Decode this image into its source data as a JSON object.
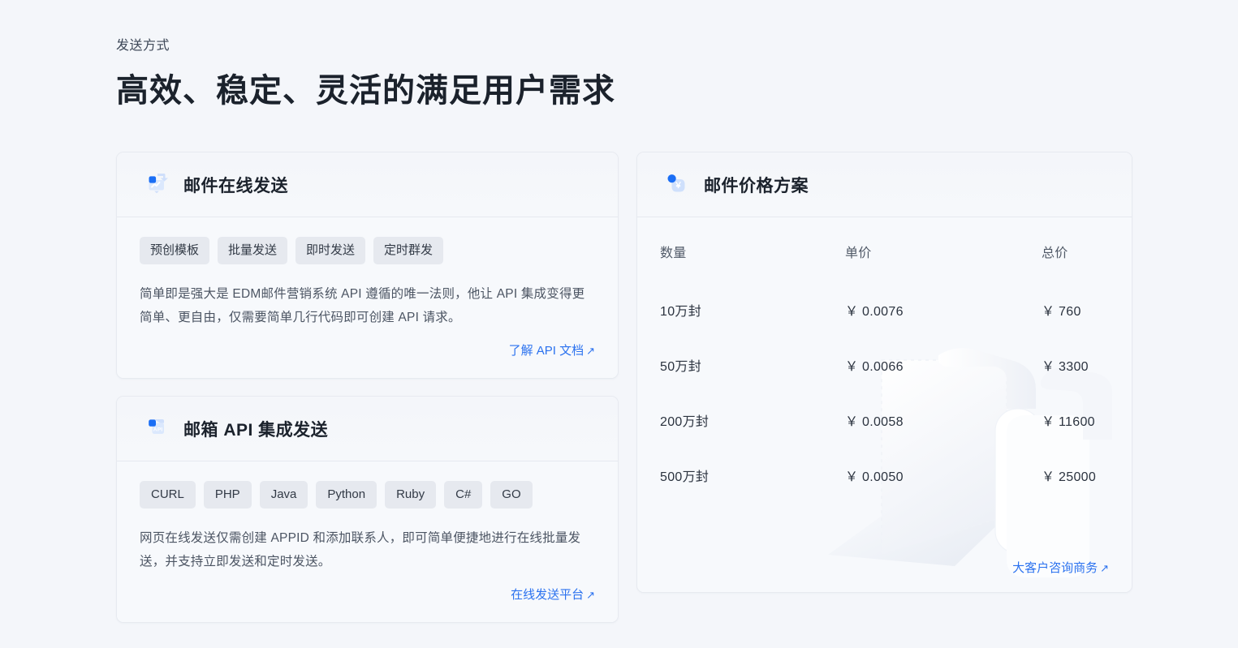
{
  "hero": {
    "eyebrow": "发送方式",
    "title": "高效、稳定、灵活的满足用户需求"
  },
  "cards": {
    "online_send": {
      "icon": "chart-screen-icon",
      "title": "邮件在线发送",
      "tags": [
        "预创模板",
        "批量发送",
        "即时发送",
        "定时群发"
      ],
      "description": "简单即是强大是 EDM邮件营销系统 API 遵循的唯一法则，他让 API 集成变得更简单、更自由，仅需要简单几行代码即可创建 API 请求。",
      "link": "了解 API 文档",
      "link_arrow": "↗"
    },
    "api_send": {
      "icon": "api-card-icon",
      "title": "邮箱 API 集成发送",
      "tags": [
        "CURL",
        "PHP",
        "Java",
        "Python",
        "Ruby",
        "C#",
        "GO"
      ],
      "description": "网页在线发送仅需创建 APPID 和添加联系人，即可简单便捷地进行在线批量发送，并支持立即发送和定时发送。",
      "link": "在线发送平台",
      "link_arrow": "↗"
    },
    "pricing": {
      "icon": "yuan-coin-icon",
      "title": "邮件价格方案",
      "columns": [
        "数量",
        "单价",
        "总价"
      ],
      "rows": [
        {
          "qty": "10万封",
          "unit": "￥ 0.0076",
          "total": "￥ 760"
        },
        {
          "qty": "50万封",
          "unit": "￥ 0.0066",
          "total": "￥ 3300"
        },
        {
          "qty": "200万封",
          "unit": "￥ 0.0058",
          "total": "￥ 11600"
        },
        {
          "qty": "500万封",
          "unit": "￥ 0.0050",
          "total": "￥ 25000"
        }
      ],
      "link": "大客户咨询商务",
      "link_arrow": "↗"
    }
  },
  "colors": {
    "page_background": "#f4f6fa",
    "card_background": "#f7f9fc",
    "accent_blue": "#2b72ef",
    "icon_blue": "#1a6ef5",
    "icon_blue_light": "#c9dcfb",
    "chip_background": "#e6e9ef",
    "border": "#e7eaf0",
    "text_primary": "#1b222c",
    "text_secondary": "#4c5563"
  }
}
